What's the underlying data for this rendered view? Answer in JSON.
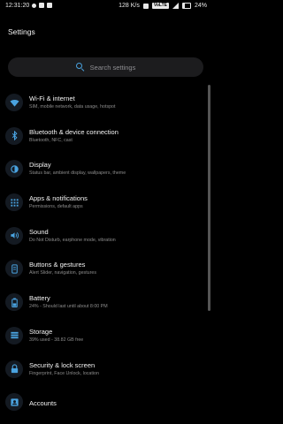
{
  "status_bar": {
    "time": "12:31:20",
    "speed": "128 K/s",
    "volte": "VoLTE",
    "battery": "24%"
  },
  "header": {
    "title": "Settings"
  },
  "search": {
    "placeholder": "Search settings"
  },
  "accent_color": "#4aa3e0",
  "items": [
    {
      "icon": "wifi-icon",
      "title": "Wi-Fi & internet",
      "subtitle": "SIM, mobile network, data usage, hotspot"
    },
    {
      "icon": "bluetooth-icon",
      "title": "Bluetooth & device connection",
      "subtitle": "Bluetooth, NFC, cast"
    },
    {
      "icon": "display-icon",
      "title": "Display",
      "subtitle": "Status bar, ambient display, wallpapers, theme"
    },
    {
      "icon": "apps-icon",
      "title": "Apps & notifications",
      "subtitle": "Permissions, default apps"
    },
    {
      "icon": "sound-icon",
      "title": "Sound",
      "subtitle": "Do Not Disturb, earphone mode, vibration"
    },
    {
      "icon": "buttons-icon",
      "title": "Buttons & gestures",
      "subtitle": "Alert Slider, navigation, gestures"
    },
    {
      "icon": "battery-icon",
      "title": "Battery",
      "subtitle": "24% - Should last until about 8:00 PM"
    },
    {
      "icon": "storage-icon",
      "title": "Storage",
      "subtitle": "39% used - 38.82 GB free"
    },
    {
      "icon": "lock-icon",
      "title": "Security & lock screen",
      "subtitle": "Fingerprint, Face Unlock, location"
    },
    {
      "icon": "accounts-icon",
      "title": "Accounts",
      "subtitle": ""
    }
  ]
}
